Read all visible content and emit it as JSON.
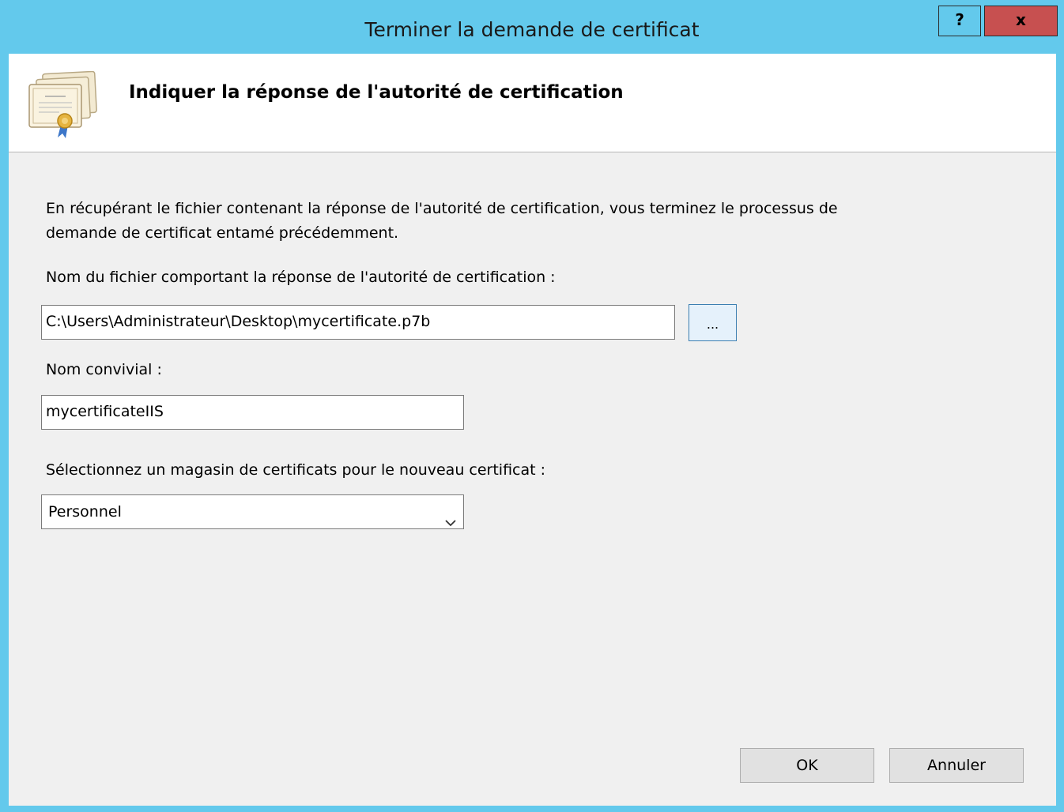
{
  "window": {
    "title": "Terminer la demande de certificat",
    "help_label": "?",
    "close_label": "x"
  },
  "header": {
    "title": "Indiquer la réponse de l'autorité de certification",
    "icon": "certificate-icon"
  },
  "description": {
    "line1": "En récupérant le fichier contenant la réponse de l'autorité de certification, vous terminez le processus de",
    "line2": "demande de certificat entamé précédemment."
  },
  "file_field": {
    "label": "Nom du fichier comportant la réponse de l'autorité de certification :",
    "value": "C:\\Users\\Administrateur\\Desktop\\mycertificate.p7b",
    "browse_label": "..."
  },
  "friendly_name": {
    "label": "Nom convivial :",
    "value": "mycertificateIIS"
  },
  "store": {
    "label": "Sélectionnez un magasin de certificats pour le nouveau certificat :",
    "selected": "Personnel"
  },
  "buttons": {
    "ok": "OK",
    "cancel": "Annuler"
  },
  "colors": {
    "titlebar": "#63c9ec",
    "close": "#c75050",
    "client_bg": "#f0f0f0"
  }
}
